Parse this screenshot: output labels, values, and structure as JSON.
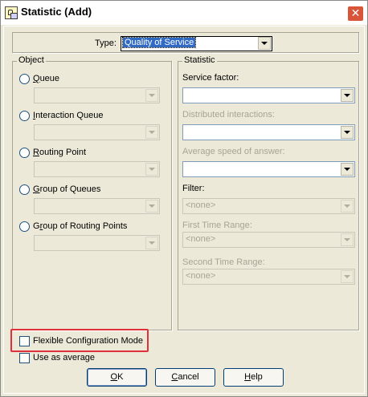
{
  "window": {
    "title": "Statistic (Add)",
    "close_glyph": "✕"
  },
  "type_row": {
    "label": "Type:",
    "value": "Quality of Service"
  },
  "object": {
    "legend": "Object",
    "options": [
      {
        "label": "Queue",
        "mnemonic": "Q",
        "rest": "ueue"
      },
      {
        "label": "Interaction Queue",
        "mnemonic": "I",
        "rest": "nteraction Queue"
      },
      {
        "label": "Routing Point",
        "mnemonic": "R",
        "rest": "outing Point"
      },
      {
        "label": "Group of Queues",
        "mnemonic": "G",
        "rest": "roup of Queues"
      },
      {
        "label": "Group of Routing Points",
        "mnemonic_prefix": "G",
        "mnemonic": "r",
        "rest": "oup of Routing Points"
      }
    ]
  },
  "statistic": {
    "legend": "Statistic",
    "service_factor": {
      "label": "Service factor:",
      "value": ""
    },
    "distributed_interactions": {
      "label": "Distributed interactions:",
      "value": ""
    },
    "average_speed": {
      "label": "Average speed of answer:",
      "value": ""
    },
    "filter": {
      "label": "Filter:",
      "value": "<none>"
    },
    "first_time_range": {
      "label": "First Time Range:",
      "value": "<none>"
    },
    "second_time_range": {
      "label": "Second Time Range:",
      "value": "<none>"
    }
  },
  "options": {
    "flexible_mode": {
      "label": "Flexible Configuration Mode",
      "checked": false
    },
    "use_as_average": {
      "label": "Use as average",
      "checked": false
    }
  },
  "buttons": {
    "ok": {
      "mnemonic": "O",
      "rest": "K"
    },
    "cancel": {
      "mnemonic": "C",
      "rest": "ancel"
    },
    "help": {
      "mnemonic": "H",
      "rest": "elp"
    }
  },
  "colors": {
    "highlight": "#e0303a",
    "dialog_bg": "#ece9d8",
    "close_button": "#d8553a"
  },
  "icons": {
    "window_icon": "statistic-window-icon",
    "dropdown": "chevron-down-icon"
  }
}
